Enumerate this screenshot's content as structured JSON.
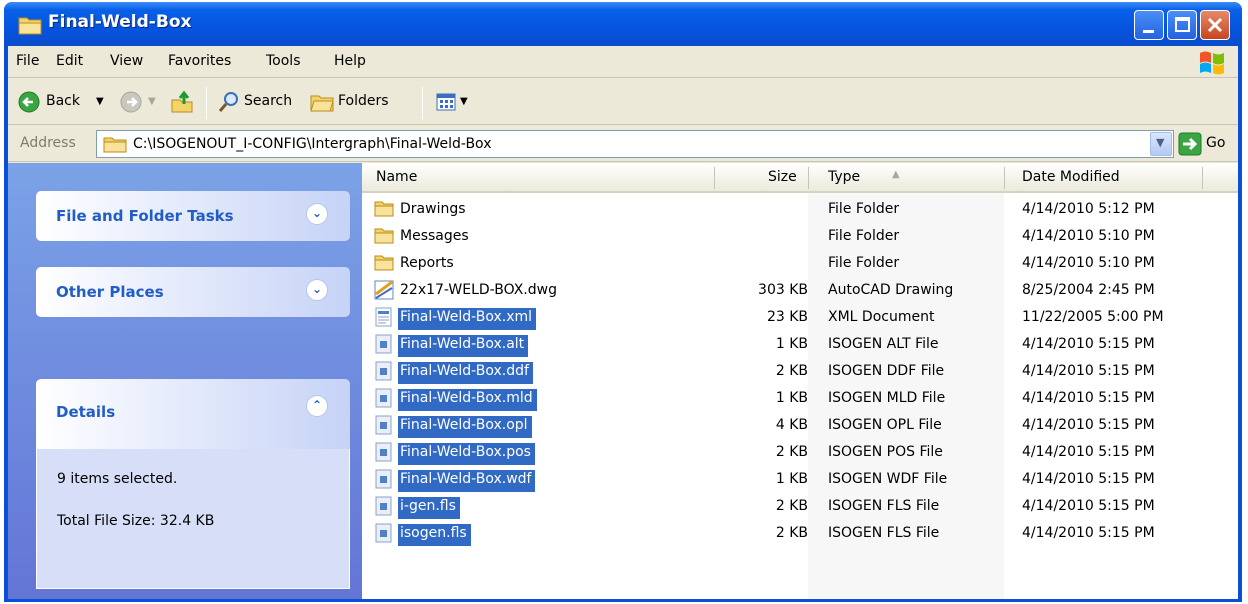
{
  "window": {
    "title": "Final-Weld-Box"
  },
  "menu": [
    "File",
    "Edit",
    "View",
    "Favorites",
    "Tools",
    "Help"
  ],
  "toolbar": {
    "back": "Back",
    "search": "Search",
    "folders": "Folders"
  },
  "address": {
    "label": "Address",
    "path": "C:\\ISOGENOUT_I-CONFIG\\Intergraph\\Final-Weld-Box",
    "go": "Go"
  },
  "tasks": {
    "file_folder_tasks": "File and Folder Tasks",
    "other_places": "Other Places",
    "details": "Details",
    "selected_text": "9 items selected.",
    "total_size_text": "Total File Size: 32.4 KB"
  },
  "columns": {
    "name": "Name",
    "size": "Size",
    "type": "Type",
    "date": "Date Modified"
  },
  "colors": {
    "selection": "#316ac5",
    "title_blue": "#0554df",
    "task_title": "#215dc6"
  },
  "files": [
    {
      "name": "Drawings",
      "size": "",
      "type": "File Folder",
      "date": "4/14/2010 5:12 PM",
      "icon": "folder-icon",
      "selected": false
    },
    {
      "name": "Messages",
      "size": "",
      "type": "File Folder",
      "date": "4/14/2010 5:10 PM",
      "icon": "folder-icon",
      "selected": false
    },
    {
      "name": "Reports",
      "size": "",
      "type": "File Folder",
      "date": "4/14/2010 5:10 PM",
      "icon": "folder-icon",
      "selected": false
    },
    {
      "name": "22x17-WELD-BOX.dwg",
      "size": "303 KB",
      "type": "AutoCAD Drawing",
      "date": "8/25/2004 2:45 PM",
      "icon": "dwg-file-icon",
      "selected": false
    },
    {
      "name": "Final-Weld-Box.xml",
      "size": "23 KB",
      "type": "XML Document",
      "date": "11/22/2005 5:00 PM",
      "icon": "xml-file-icon",
      "selected": true
    },
    {
      "name": "Final-Weld-Box.alt",
      "size": "1 KB",
      "type": "ISOGEN ALT File",
      "date": "4/14/2010 5:15 PM",
      "icon": "file-icon",
      "selected": true
    },
    {
      "name": "Final-Weld-Box.ddf",
      "size": "2 KB",
      "type": "ISOGEN DDF File",
      "date": "4/14/2010 5:15 PM",
      "icon": "file-icon",
      "selected": true
    },
    {
      "name": "Final-Weld-Box.mld",
      "size": "1 KB",
      "type": "ISOGEN MLD File",
      "date": "4/14/2010 5:15 PM",
      "icon": "file-icon",
      "selected": true
    },
    {
      "name": "Final-Weld-Box.opl",
      "size": "4 KB",
      "type": "ISOGEN OPL File",
      "date": "4/14/2010 5:15 PM",
      "icon": "file-icon",
      "selected": true
    },
    {
      "name": "Final-Weld-Box.pos",
      "size": "2 KB",
      "type": "ISOGEN POS File",
      "date": "4/14/2010 5:15 PM",
      "icon": "file-icon",
      "selected": true
    },
    {
      "name": "Final-Weld-Box.wdf",
      "size": "1 KB",
      "type": "ISOGEN WDF File",
      "date": "4/14/2010 5:15 PM",
      "icon": "file-icon",
      "selected": true
    },
    {
      "name": "i-gen.fls",
      "size": "2 KB",
      "type": "ISOGEN FLS File",
      "date": "4/14/2010 5:15 PM",
      "icon": "file-icon",
      "selected": true
    },
    {
      "name": "isogen.fls",
      "size": "2 KB",
      "type": "ISOGEN FLS File",
      "date": "4/14/2010 5:15 PM",
      "icon": "file-icon",
      "selected": true
    }
  ]
}
